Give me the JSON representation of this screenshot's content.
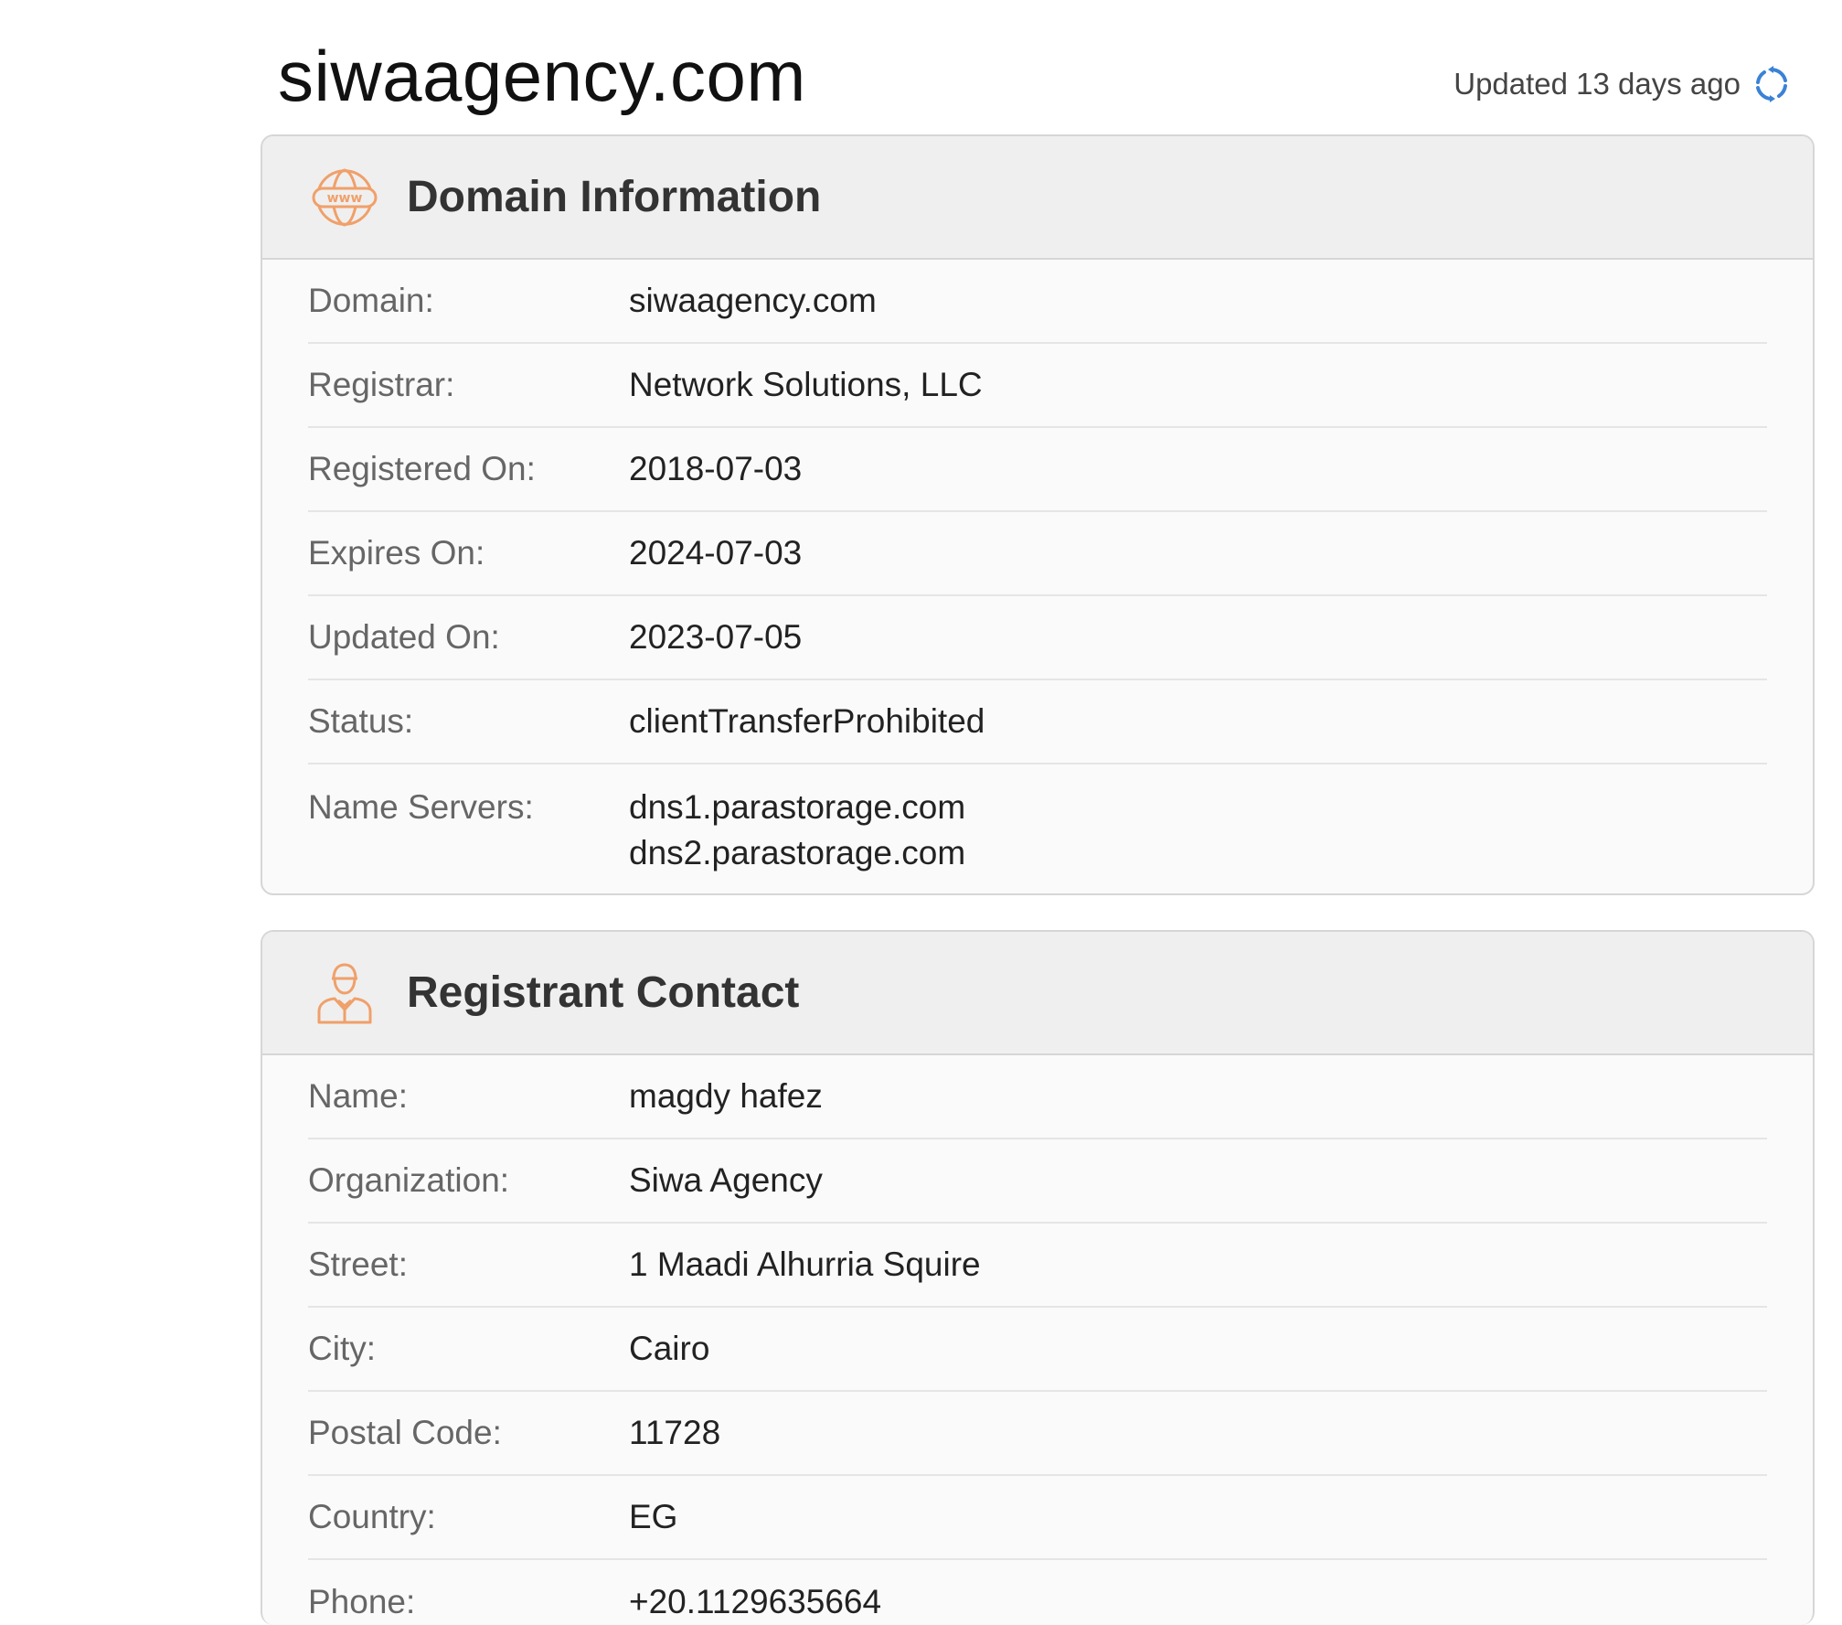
{
  "header": {
    "site_title": "siwaagency.com",
    "updated_text": "Updated 13 days ago",
    "refresh_icon": "refresh-icon"
  },
  "domain_info": {
    "title": "Domain Information",
    "icon": "www-globe-icon",
    "rows": [
      {
        "label": "Domain:",
        "value": "siwaagency.com"
      },
      {
        "label": "Registrar:",
        "value": "Network Solutions, LLC"
      },
      {
        "label": "Registered On:",
        "value": "2018-07-03"
      },
      {
        "label": "Expires On:",
        "value": "2024-07-03"
      },
      {
        "label": "Updated On:",
        "value": "2023-07-05"
      },
      {
        "label": "Status:",
        "value": "clientTransferProhibited"
      }
    ],
    "name_servers": {
      "label": "Name Servers:",
      "values": [
        "dns1.parastorage.com",
        "dns2.parastorage.com"
      ]
    }
  },
  "registrant": {
    "title": "Registrant Contact",
    "icon": "person-icon",
    "rows": [
      {
        "label": "Name:",
        "value": "magdy hafez"
      },
      {
        "label": "Organization:",
        "value": "Siwa Agency"
      },
      {
        "label": "Street:",
        "value": "1 Maadi Alhurria Squire"
      },
      {
        "label": "City:",
        "value": "Cairo"
      },
      {
        "label": "Postal Code:",
        "value": "11728"
      },
      {
        "label": "Country:",
        "value": "EG"
      },
      {
        "label": "Phone:",
        "value": "+20.1129635664"
      }
    ]
  },
  "colors": {
    "accent_orange": "#f0a06a",
    "refresh_blue": "#3b82d6"
  }
}
